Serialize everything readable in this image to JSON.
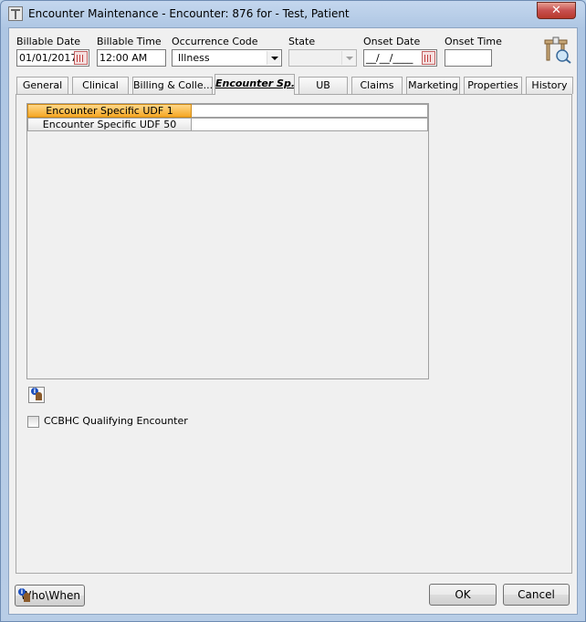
{
  "window": {
    "title": "Encounter Maintenance - Encounter: 876 for - Test, Patient",
    "close_label": "✕"
  },
  "header": {
    "billable_date": {
      "label": "Billable Date",
      "value": "01/01/2017"
    },
    "billable_time": {
      "label": "Billable Time",
      "value": "12:00 AM"
    },
    "occurrence_code": {
      "label": "Occurrence Code",
      "value": "Illness"
    },
    "state": {
      "label": "State",
      "value": ""
    },
    "onset_date": {
      "label": "Onset Date",
      "value": "__/__/____"
    },
    "onset_time": {
      "label": "Onset Time",
      "value": ""
    }
  },
  "tabs": [
    {
      "label": "General"
    },
    {
      "label": "Clinical"
    },
    {
      "label": "Billing & Colle..."
    },
    {
      "label": "Encounter Sp..."
    },
    {
      "label": "UB"
    },
    {
      "label": "Claims"
    },
    {
      "label": "Marketing"
    },
    {
      "label": "Properties"
    },
    {
      "label": "History"
    }
  ],
  "active_tab": "Encounter Sp...",
  "udf_grid": {
    "rows": [
      {
        "name": "Encounter Specific UDF 1",
        "value": ""
      },
      {
        "name": "Encounter Specific UDF 50",
        "value": ""
      }
    ]
  },
  "ccbhc": {
    "label": "CCBHC Qualifying Encounter",
    "checked": false
  },
  "footer": {
    "whowhen_label": "Who\\When",
    "ok_label": "OK",
    "cancel_label": "Cancel"
  },
  "icons": {
    "window": "window-app-icon",
    "toolbar": "encounter-tools-icon",
    "info": "info-person-icon",
    "whowhen": "info-person-icon"
  }
}
